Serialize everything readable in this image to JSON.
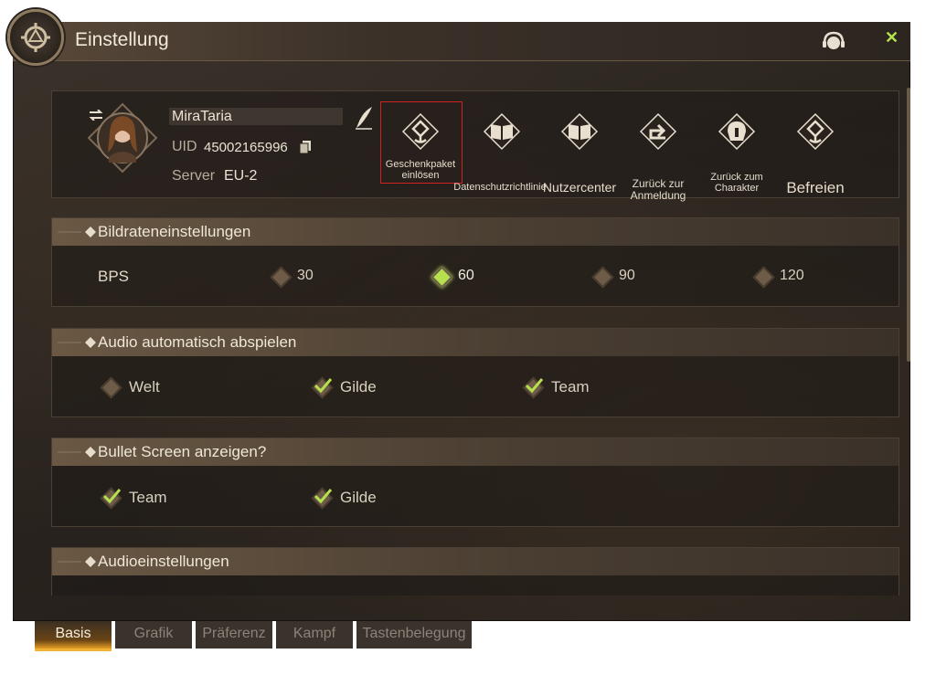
{
  "window": {
    "title": "Einstellung"
  },
  "profile": {
    "name": "MiraTaria",
    "uid_label": "UID",
    "uid_value": "45002165996",
    "server_label": "Server",
    "server_value": "EU-2"
  },
  "actions": [
    {
      "label": "Geschenkpaket einlösen",
      "icon": "gift-rune-icon"
    },
    {
      "label": "Datenschutzrichtlinie",
      "icon": "open-book-icon"
    },
    {
      "label": "Nutzercenter",
      "icon": "open-book-icon"
    },
    {
      "label": "Zurück zur Anmeldung",
      "icon": "return-arrow-icon"
    },
    {
      "label": "Zurück zum Charakter",
      "icon": "helmet-icon"
    },
    {
      "label": "Befreien",
      "icon": "unstuck-rune-icon"
    }
  ],
  "sections": {
    "framerate": {
      "title": "Bildrateneinstellungen",
      "row_label": "BPS",
      "options": [
        "30",
        "60",
        "90",
        "120"
      ],
      "selected": "60"
    },
    "autoplay": {
      "title": "Audio automatisch abspielen",
      "options": [
        {
          "label": "Welt",
          "checked": false
        },
        {
          "label": "Gilde",
          "checked": true
        },
        {
          "label": "Team",
          "checked": true
        }
      ]
    },
    "bullet": {
      "title": "Bullet Screen anzeigen?",
      "options": [
        {
          "label": "Team",
          "checked": true
        },
        {
          "label": "Gilde",
          "checked": true
        }
      ]
    },
    "audio": {
      "title": "Audioeinstellungen"
    }
  },
  "tabs": [
    {
      "label": "Basis",
      "active": true
    },
    {
      "label": "Grafik",
      "active": false
    },
    {
      "label": "Präferenz",
      "active": false
    },
    {
      "label": "Kampf",
      "active": false
    },
    {
      "label": "Tastenbelegung",
      "active": false
    }
  ],
  "colors": {
    "accent": "#b6e04d",
    "tab_active": "#e39a22",
    "highlight_box": "#d21f1f"
  }
}
